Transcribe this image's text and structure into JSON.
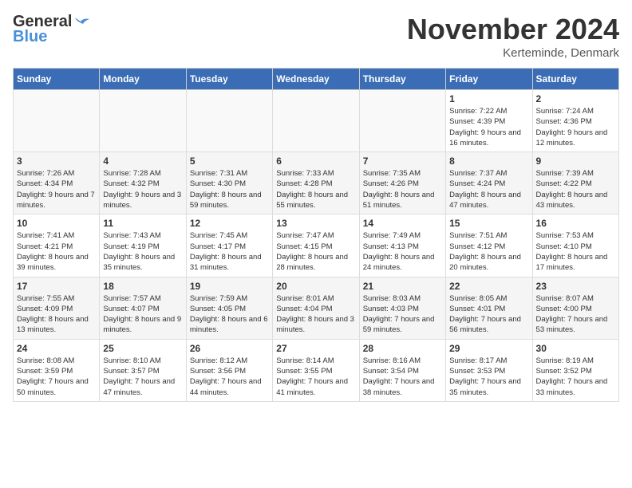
{
  "header": {
    "logo_line1": "General",
    "logo_line2": "Blue",
    "month_title": "November 2024",
    "location": "Kerteminde, Denmark"
  },
  "weekdays": [
    "Sunday",
    "Monday",
    "Tuesday",
    "Wednesday",
    "Thursday",
    "Friday",
    "Saturday"
  ],
  "weeks": [
    [
      {
        "day": "",
        "info": ""
      },
      {
        "day": "",
        "info": ""
      },
      {
        "day": "",
        "info": ""
      },
      {
        "day": "",
        "info": ""
      },
      {
        "day": "",
        "info": ""
      },
      {
        "day": "1",
        "info": "Sunrise: 7:22 AM\nSunset: 4:39 PM\nDaylight: 9 hours and 16 minutes."
      },
      {
        "day": "2",
        "info": "Sunrise: 7:24 AM\nSunset: 4:36 PM\nDaylight: 9 hours and 12 minutes."
      }
    ],
    [
      {
        "day": "3",
        "info": "Sunrise: 7:26 AM\nSunset: 4:34 PM\nDaylight: 9 hours and 7 minutes."
      },
      {
        "day": "4",
        "info": "Sunrise: 7:28 AM\nSunset: 4:32 PM\nDaylight: 9 hours and 3 minutes."
      },
      {
        "day": "5",
        "info": "Sunrise: 7:31 AM\nSunset: 4:30 PM\nDaylight: 8 hours and 59 minutes."
      },
      {
        "day": "6",
        "info": "Sunrise: 7:33 AM\nSunset: 4:28 PM\nDaylight: 8 hours and 55 minutes."
      },
      {
        "day": "7",
        "info": "Sunrise: 7:35 AM\nSunset: 4:26 PM\nDaylight: 8 hours and 51 minutes."
      },
      {
        "day": "8",
        "info": "Sunrise: 7:37 AM\nSunset: 4:24 PM\nDaylight: 8 hours and 47 minutes."
      },
      {
        "day": "9",
        "info": "Sunrise: 7:39 AM\nSunset: 4:22 PM\nDaylight: 8 hours and 43 minutes."
      }
    ],
    [
      {
        "day": "10",
        "info": "Sunrise: 7:41 AM\nSunset: 4:21 PM\nDaylight: 8 hours and 39 minutes."
      },
      {
        "day": "11",
        "info": "Sunrise: 7:43 AM\nSunset: 4:19 PM\nDaylight: 8 hours and 35 minutes."
      },
      {
        "day": "12",
        "info": "Sunrise: 7:45 AM\nSunset: 4:17 PM\nDaylight: 8 hours and 31 minutes."
      },
      {
        "day": "13",
        "info": "Sunrise: 7:47 AM\nSunset: 4:15 PM\nDaylight: 8 hours and 28 minutes."
      },
      {
        "day": "14",
        "info": "Sunrise: 7:49 AM\nSunset: 4:13 PM\nDaylight: 8 hours and 24 minutes."
      },
      {
        "day": "15",
        "info": "Sunrise: 7:51 AM\nSunset: 4:12 PM\nDaylight: 8 hours and 20 minutes."
      },
      {
        "day": "16",
        "info": "Sunrise: 7:53 AM\nSunset: 4:10 PM\nDaylight: 8 hours and 17 minutes."
      }
    ],
    [
      {
        "day": "17",
        "info": "Sunrise: 7:55 AM\nSunset: 4:09 PM\nDaylight: 8 hours and 13 minutes."
      },
      {
        "day": "18",
        "info": "Sunrise: 7:57 AM\nSunset: 4:07 PM\nDaylight: 8 hours and 9 minutes."
      },
      {
        "day": "19",
        "info": "Sunrise: 7:59 AM\nSunset: 4:05 PM\nDaylight: 8 hours and 6 minutes."
      },
      {
        "day": "20",
        "info": "Sunrise: 8:01 AM\nSunset: 4:04 PM\nDaylight: 8 hours and 3 minutes."
      },
      {
        "day": "21",
        "info": "Sunrise: 8:03 AM\nSunset: 4:03 PM\nDaylight: 7 hours and 59 minutes."
      },
      {
        "day": "22",
        "info": "Sunrise: 8:05 AM\nSunset: 4:01 PM\nDaylight: 7 hours and 56 minutes."
      },
      {
        "day": "23",
        "info": "Sunrise: 8:07 AM\nSunset: 4:00 PM\nDaylight: 7 hours and 53 minutes."
      }
    ],
    [
      {
        "day": "24",
        "info": "Sunrise: 8:08 AM\nSunset: 3:59 PM\nDaylight: 7 hours and 50 minutes."
      },
      {
        "day": "25",
        "info": "Sunrise: 8:10 AM\nSunset: 3:57 PM\nDaylight: 7 hours and 47 minutes."
      },
      {
        "day": "26",
        "info": "Sunrise: 8:12 AM\nSunset: 3:56 PM\nDaylight: 7 hours and 44 minutes."
      },
      {
        "day": "27",
        "info": "Sunrise: 8:14 AM\nSunset: 3:55 PM\nDaylight: 7 hours and 41 minutes."
      },
      {
        "day": "28",
        "info": "Sunrise: 8:16 AM\nSunset: 3:54 PM\nDaylight: 7 hours and 38 minutes."
      },
      {
        "day": "29",
        "info": "Sunrise: 8:17 AM\nSunset: 3:53 PM\nDaylight: 7 hours and 35 minutes."
      },
      {
        "day": "30",
        "info": "Sunrise: 8:19 AM\nSunset: 3:52 PM\nDaylight: 7 hours and 33 minutes."
      }
    ]
  ]
}
